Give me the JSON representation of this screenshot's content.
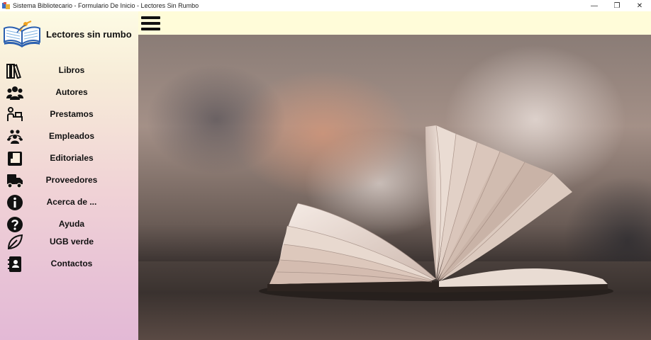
{
  "window": {
    "title": "Sistema Bibliotecario - Formulario De Inicio - Lectores Sin Rumbo",
    "controls": {
      "minimize": "—",
      "restore": "❐",
      "close": "✕"
    }
  },
  "brand": {
    "name": "Lectores sin rumbo"
  },
  "menu": [
    {
      "label": "Libros",
      "icon": "books-icon"
    },
    {
      "label": "Autores",
      "icon": "users-group-icon"
    },
    {
      "label": "Prestamos",
      "icon": "loan-desk-icon"
    },
    {
      "label": "Empleados",
      "icon": "employees-icon"
    },
    {
      "label": "Editoriales",
      "icon": "book-icon"
    },
    {
      "label": "Proveedores",
      "icon": "truck-icon"
    },
    {
      "label": "Acerca de ...",
      "icon": "info-icon"
    },
    {
      "label": "Ayuda",
      "icon": "help-icon"
    },
    {
      "label": "UGB verde",
      "icon": "leaf-icon"
    },
    {
      "label": "Contactos",
      "icon": "contacts-book-icon"
    }
  ],
  "colors": {
    "topbar": "#fffcd9",
    "sidebar_top": "#fdfbe4",
    "sidebar_bottom": "#e3b9d6"
  }
}
